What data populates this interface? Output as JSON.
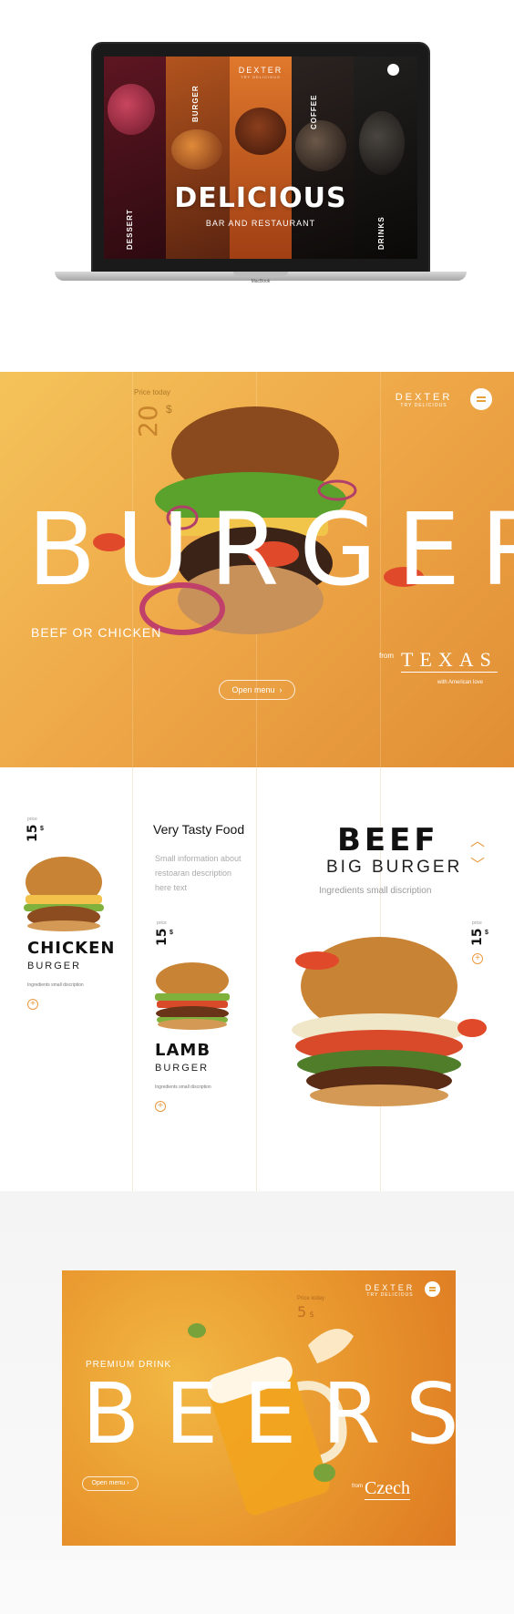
{
  "laptop": {
    "brand": "DEXTER",
    "brand_tagline": "TRY DELICIOUS",
    "panels": [
      "DESSERT",
      "BURGER",
      "COFFEE",
      "DRINKS"
    ],
    "title": "DELICIOUS",
    "subtitle": "BAR AND RESTAURANT",
    "device_label": "MacBook"
  },
  "hero": {
    "price_label": "Price today",
    "price_value": "20",
    "price_unit": "$",
    "brand": "DEXTER",
    "brand_tagline": "TRY DELICIOUS",
    "word": "BURGER",
    "subtitle": "BEEF OR CHICKEN",
    "from_label": "from",
    "from_place": "TEXAS",
    "from_note": "with American love",
    "open_menu_label": "Open menu",
    "open_menu_arrow": "›",
    "colors": {
      "accent": "#efa949",
      "accent_dark": "#e18e34"
    }
  },
  "menu": {
    "items": [
      {
        "price_label": "price",
        "price": "15",
        "currency": "$",
        "title": "CHICKEN",
        "type": "BURGER",
        "desc": "Ingredients small discription",
        "add": "+"
      },
      {
        "price_label": "price",
        "price": "15",
        "currency": "$",
        "title": "LAMB",
        "type": "BURGER",
        "desc": "Ingredients small discription",
        "add": "+"
      }
    ],
    "tasty_title": "Very Tasty Food",
    "tasty_text": "Small information about restoaran description here text",
    "featured": {
      "title": "BEEF",
      "type": "BIG BURGER",
      "ingredients": "Ingredients small discription",
      "price_label": "price",
      "price": "15",
      "currency": "$",
      "add": "+"
    },
    "nav_up": "︿",
    "nav_down": "﹀"
  },
  "beer": {
    "price_label": "Price today",
    "price_value": "5",
    "price_unit": "$",
    "brand": "DEXTER",
    "brand_tagline": "TRY DELICIOUS",
    "premium": "PREMIUM DRINK",
    "word": "BEERS",
    "open_menu_label": "Open menu",
    "open_menu_arrow": "›",
    "from_label": "from",
    "from_place": "Czech"
  }
}
